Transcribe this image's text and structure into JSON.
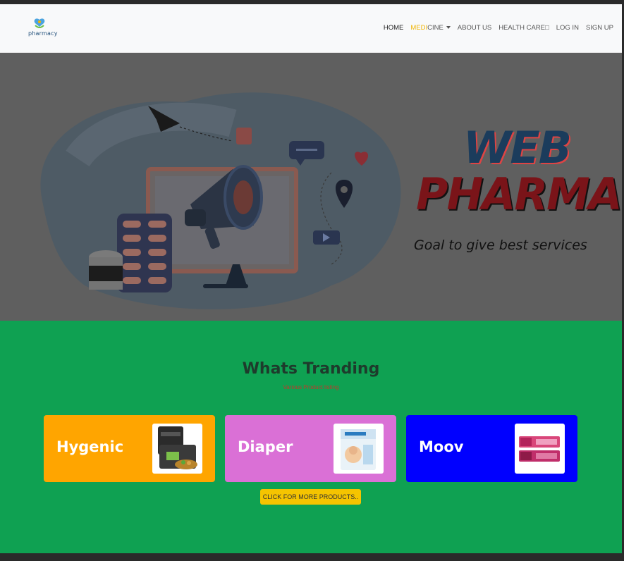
{
  "navbar": {
    "logo_text": "pharmacy",
    "items": [
      {
        "label": "HOME"
      },
      {
        "label_highlight": "MEDI",
        "label_rest": "CINE"
      },
      {
        "label": "ABOUT US"
      },
      {
        "label": "HEALTH CARE□"
      },
      {
        "label": "LOG IN"
      },
      {
        "label": "SIGN UP"
      }
    ]
  },
  "hero": {
    "title_line1": "WEB",
    "title_line2": "PHARMA",
    "subtitle": "Goal to give best services"
  },
  "trending": {
    "title": "Whats Tranding",
    "subtitle": "Various Product listing",
    "cards": [
      {
        "label": "Hygenic",
        "color": "#ffa500",
        "thumb_icon": "hygiene-products-image"
      },
      {
        "label": "Diaper",
        "color": "#da70d6",
        "thumb_icon": "diaper-pack-image"
      },
      {
        "label": "Moov",
        "color": "#0000ff",
        "thumb_icon": "moov-cream-image"
      }
    ],
    "more_button": "CLICK FOR MORE PRODUCTS.."
  },
  "colors": {
    "accent": "#f5c400",
    "trending_bg": "#0fa152",
    "hero_bg": "#5f5f5f"
  }
}
